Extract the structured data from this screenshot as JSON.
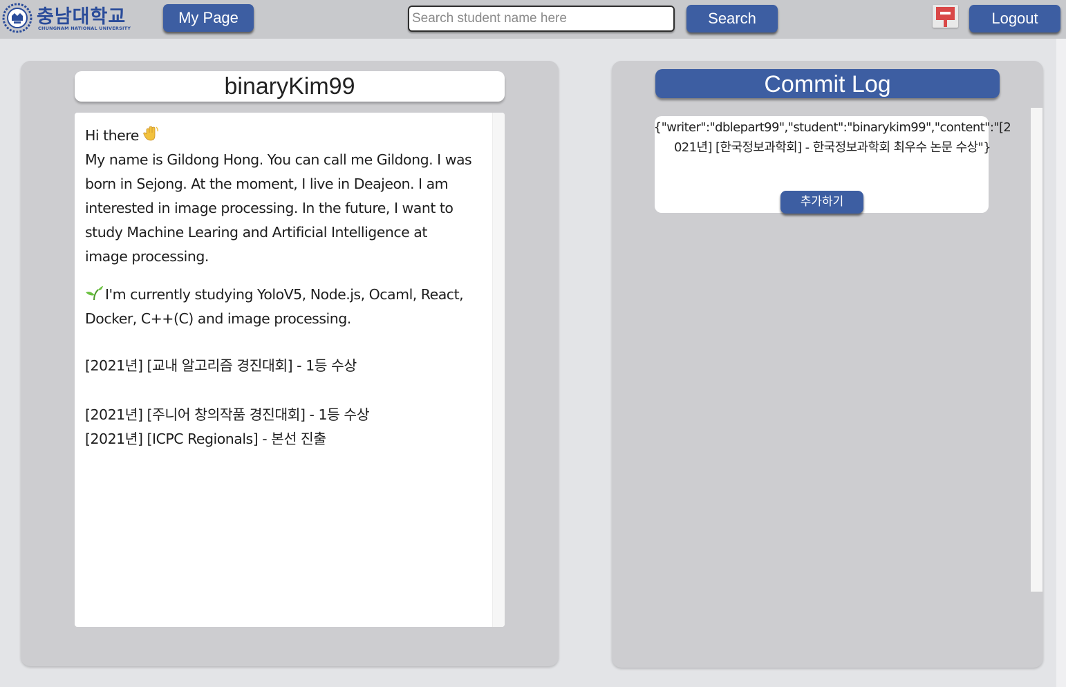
{
  "header": {
    "logo_korean": "충남대학교",
    "logo_english": "CHUNGNAM NATIONAL UNIVERSITY",
    "mypage_label": "My Page",
    "search_placeholder": "Search student name here",
    "search_value": "",
    "search_label": "Search",
    "logout_label": "Logout",
    "brand_color": "#3d5ea2"
  },
  "profile": {
    "username": "binaryKim99",
    "readme": {
      "greeting": "Hi there",
      "intro": "My name is Gildong Hong. You can call me Gildong. I was born in Sejong. At the moment, I live in Deajeon. I am interested in image processing. In the future, I want to study Machine Learing and Artificial Intelligence at image processing.",
      "studying": "I'm currently studying YoloV5, Node.js, Ocaml, React, Docker, C++(C) and image processing.",
      "award_1": "[2021년] [교내 알고리즘 경진대회] - 1등 수상",
      "award_2": "[2021년] [주니어 창의작품 경진대회] - 1등 수상",
      "award_3": "[2021년] [ICPC Regionals] - 본선 진출"
    }
  },
  "commit_log": {
    "title": "Commit Log",
    "entries": [
      {
        "text": "{\"writer\":\"dblepart99\",\"student\":\"binarykim99\",\"content\":\"[2021년] [한국정보과학회] - 한국정보과학회 최우수 논문 수상\"}",
        "add_label": "추가하기"
      }
    ]
  },
  "icons": {
    "wave": "waving-hand-icon",
    "sprout": "seedling-icon",
    "flag": "flag-icon",
    "emblem": "university-emblem-icon"
  }
}
